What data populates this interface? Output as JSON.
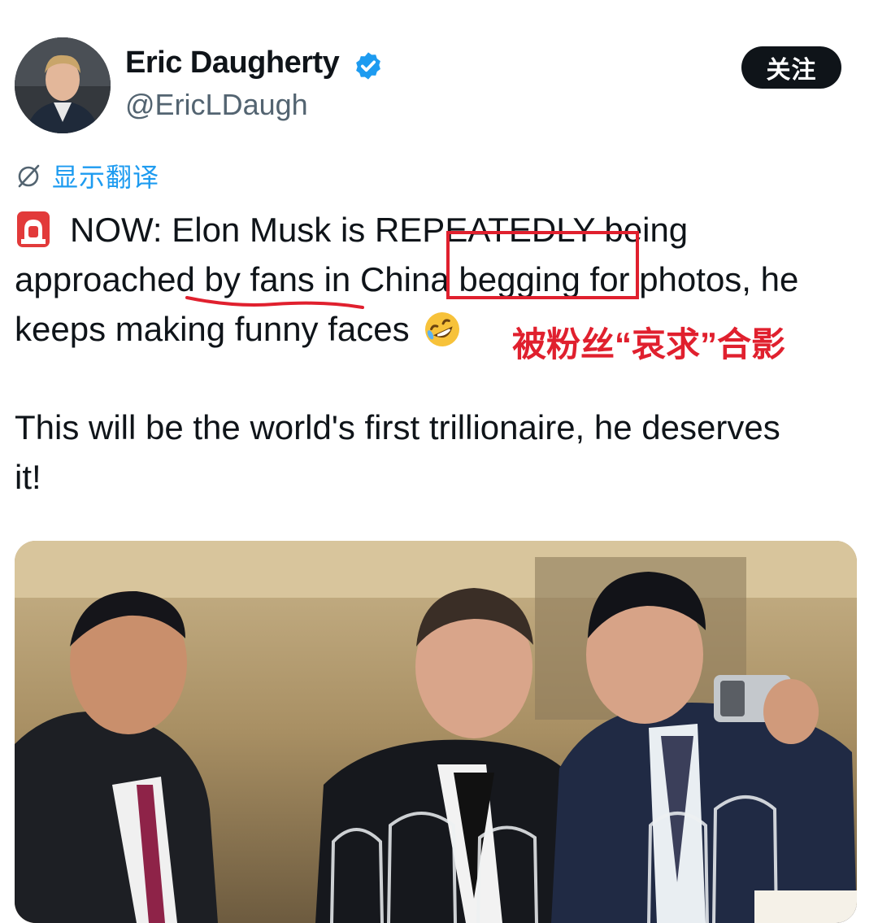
{
  "user": {
    "display_name": "Eric Daugherty",
    "handle": "@EricLDaugh",
    "follow_label": "关注"
  },
  "translate": {
    "label": "显示翻译"
  },
  "tweet": {
    "line1": "NOW: Elon Musk is REPEATEDLY being",
    "line2": "approached by fans in China begging for photos, he",
    "line3": "keeps making funny faces",
    "line4": "This will be the world's first trillionaire, he deserves",
    "line5": "it!"
  },
  "annotation": {
    "label": "被粉丝“哀求”合影"
  },
  "colors": {
    "accent": "#1d9bf0",
    "annotation": "#e0202e",
    "follow_bg": "#0f1419"
  },
  "icons": [
    "verified-badge-icon",
    "translate-icon",
    "siren-icon",
    "rolling-laughing-emoji-icon"
  ]
}
